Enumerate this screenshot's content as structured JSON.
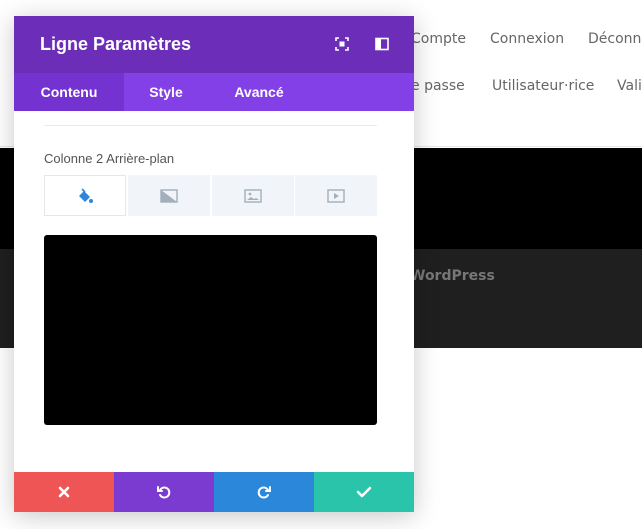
{
  "background_page": {
    "nav_row1": [
      "Compte",
      "Connexion",
      "Déconn"
    ],
    "nav_row2": [
      "e passe",
      "Utilisateur·rice",
      "Vali"
    ],
    "footer_text": "WordPress"
  },
  "modal": {
    "title": "Ligne Paramètres",
    "header_icons": [
      "expand-icon",
      "sidebar-toggle-icon"
    ],
    "tabs": [
      {
        "label": "Contenu",
        "active": true
      },
      {
        "label": "Style",
        "active": false
      },
      {
        "label": "Avancé",
        "active": false
      }
    ],
    "section_label": "Colonne 2 Arrière-plan",
    "background_types": [
      {
        "icon": "paint-bucket-icon",
        "active": true
      },
      {
        "icon": "gradient-icon",
        "active": false
      },
      {
        "icon": "image-icon",
        "active": false
      },
      {
        "icon": "video-icon",
        "active": false
      }
    ],
    "preview_color": "#000000",
    "footer_buttons": [
      {
        "icon": "close-icon",
        "color": "#ef5555"
      },
      {
        "icon": "undo-icon",
        "color": "#7c3bd0"
      },
      {
        "icon": "redo-icon",
        "color": "#2b87da"
      },
      {
        "icon": "check-icon",
        "color": "#29c4a9"
      }
    ]
  },
  "colors": {
    "header": "#6c2eb9",
    "tabs": "#8240e6",
    "active_tab": "#7433d1",
    "accent_blue": "#2b87da"
  }
}
